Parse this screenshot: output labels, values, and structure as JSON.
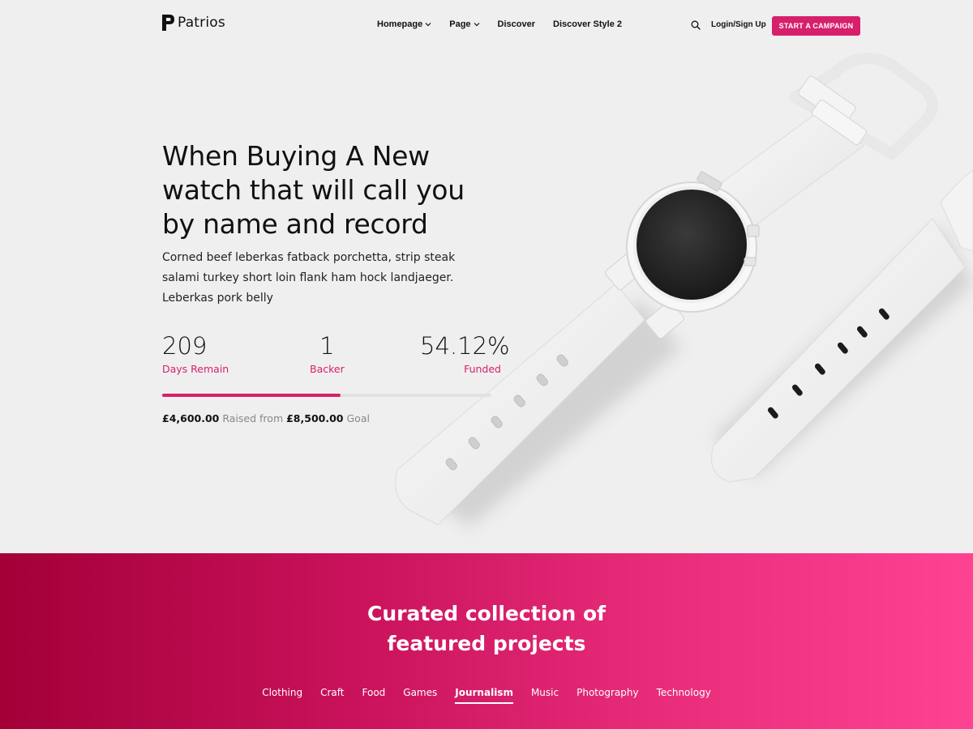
{
  "header": {
    "logo_text": "Patrios",
    "nav": [
      {
        "label": "Homepage",
        "has_dropdown": true
      },
      {
        "label": "Page",
        "has_dropdown": true
      },
      {
        "label": "Discover",
        "has_dropdown": false
      },
      {
        "label": "Discover Style 2",
        "has_dropdown": false
      }
    ],
    "search_icon": "search-icon",
    "login_label": "Login/Sign Up",
    "cta_label": "START A CAMPAIGN"
  },
  "hero": {
    "title": "When Buying A New watch that will call you by name and record",
    "description": "Corned beef leberkas fatback porchetta, strip steak salami turkey short loin flank ham hock landjaeger. Leberkas pork belly",
    "stats": [
      {
        "value": "209",
        "label": "Days Remain"
      },
      {
        "value": "1",
        "label": "Backer"
      },
      {
        "value": "54.12%",
        "label": "Funded"
      }
    ],
    "progress_fraction": 0.5412,
    "raised_amount": "£4,600.00",
    "raised_text": "Raised from",
    "goal_amount": "£8,500.00",
    "goal_text": "Goal"
  },
  "featured": {
    "title_line1": "Curated collection of",
    "title_line2": "featured projects",
    "categories": [
      "Clothing",
      "Craft",
      "Food",
      "Games",
      "Journalism",
      "Music",
      "Photography",
      "Technology"
    ],
    "active_category": "Journalism"
  },
  "colors": {
    "accent": "#d6206b",
    "gradient_start": "#a30038",
    "gradient_end": "#ff4393"
  }
}
